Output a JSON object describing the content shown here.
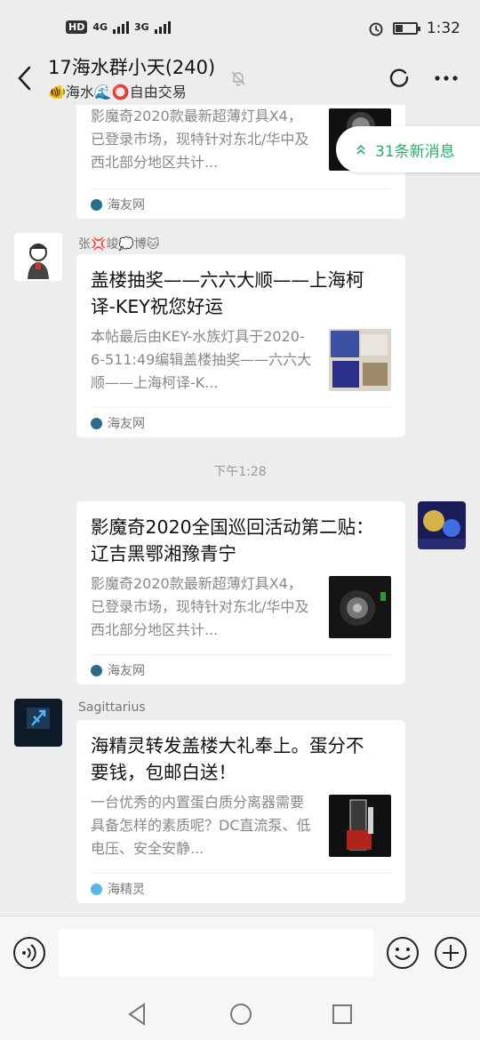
{
  "status_bar": {
    "hd": "HD",
    "net1": "4G",
    "net2": "3G",
    "time": "1:32",
    "battery_level": 0.35
  },
  "header": {
    "title": "17海水群小天(240)",
    "subtitle": "🐠海水🌊⭕自由交易"
  },
  "new_messages": {
    "label": "31条新消息"
  },
  "messages": [
    {
      "type": "incoming",
      "title": "",
      "desc": "影魔奇2020款最新超薄灯具X4，已登录市场，现特针对东北/华中及西北部分地区共计...",
      "source": "海友网"
    },
    {
      "type": "incoming",
      "sender": "张💢竣💭博🐱",
      "title": "盖楼抽奖——六六大顺——上海柯译-KEY祝您好运",
      "desc": "本帖最后由KEY-水族灯具于2020-6-511:49编辑盖楼抽奖——六六大顺——上海柯译-K...",
      "source": "海友网"
    },
    {
      "type": "time",
      "text": "下午1:28"
    },
    {
      "type": "outgoing",
      "title": "影魔奇2020全国巡回活动第二贴： 辽吉黑鄂湘豫青宁",
      "desc": "影魔奇2020款最新超薄灯具X4，已登录市场，现特针对东北/华中及西北部分地区共计...",
      "source": "海友网"
    },
    {
      "type": "incoming",
      "sender": "Sagittarius",
      "title": "海精灵转发盖楼大礼奉上。蛋分不要钱，包邮白送！",
      "desc": "一台优秀的内置蛋白质分离器需要具备怎样的素质呢？DC直流泵、低电压、安全安静...",
      "source": "海精灵"
    }
  ],
  "input": {
    "value": ""
  },
  "colors": {
    "bg": "#ededed",
    "accent_green": "#2aae67",
    "card": "#ffffff"
  }
}
